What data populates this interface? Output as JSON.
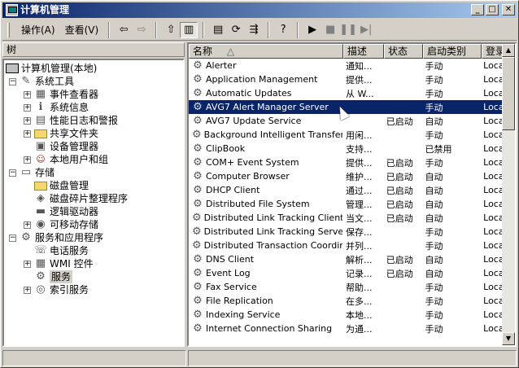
{
  "window": {
    "title": "计算机管理"
  },
  "menu": {
    "action": "操作(A)",
    "view": "查看(V)"
  },
  "toolbar": {
    "back": "⇦",
    "forward": "⇨",
    "up": "⇧",
    "show_tree": "▥",
    "properties": "▤",
    "refresh": "⟳",
    "export": "⇶",
    "help": "?",
    "play": "▶",
    "stop": "■",
    "pause": "❚❚",
    "restart": "▶|"
  },
  "left": {
    "header": "树",
    "tree": [
      {
        "label": "计算机管理(本地)",
        "indent": 0,
        "expander": "",
        "icon": "pc-icon",
        "glyph": ""
      },
      {
        "label": "系统工具",
        "indent": 1,
        "expander": "−",
        "icon": "tools-icon",
        "glyph": "✎"
      },
      {
        "label": "事件查看器",
        "indent": 2,
        "expander": "+",
        "icon": "event-viewer-icon",
        "glyph": "▦"
      },
      {
        "label": "系统信息",
        "indent": 2,
        "expander": "+",
        "icon": "system-info-icon",
        "glyph": "ℹ"
      },
      {
        "label": "性能日志和警报",
        "indent": 2,
        "expander": "+",
        "icon": "perf-log-icon",
        "glyph": "▤"
      },
      {
        "label": "共享文件夹",
        "indent": 2,
        "expander": "+",
        "icon": "shared-folder-icon",
        "glyph": ""
      },
      {
        "label": "设备管理器",
        "indent": 2,
        "expander": "",
        "icon": "device-manager-icon",
        "glyph": "▣"
      },
      {
        "label": "本地用户和组",
        "indent": 2,
        "expander": "+",
        "icon": "users-icon",
        "glyph": "☺"
      },
      {
        "label": "存储",
        "indent": 1,
        "expander": "−",
        "icon": "storage-icon",
        "glyph": "▭"
      },
      {
        "label": "磁盘管理",
        "indent": 2,
        "expander": "",
        "icon": "disk-mgmt-icon",
        "glyph": ""
      },
      {
        "label": "磁盘碎片整理程序",
        "indent": 2,
        "expander": "",
        "icon": "defrag-icon",
        "glyph": "◈"
      },
      {
        "label": "逻辑驱动器",
        "indent": 2,
        "expander": "",
        "icon": "logical-drive-icon",
        "glyph": "▬"
      },
      {
        "label": "可移动存储",
        "indent": 2,
        "expander": "+",
        "icon": "removable-storage-icon",
        "glyph": "◉"
      },
      {
        "label": "服务和应用程序",
        "indent": 1,
        "expander": "−",
        "icon": "services-apps-icon",
        "glyph": "⚙"
      },
      {
        "label": "电话服务",
        "indent": 2,
        "expander": "",
        "icon": "telephony-icon",
        "glyph": "☏"
      },
      {
        "label": "WMI 控件",
        "indent": 2,
        "expander": "+",
        "icon": "wmi-icon",
        "glyph": "▦"
      },
      {
        "label": "服务",
        "indent": 2,
        "expander": "",
        "icon": "services-icon",
        "glyph": "⚙"
      },
      {
        "label": "索引服务",
        "indent": 2,
        "expander": "+",
        "icon": "index-icon",
        "glyph": "◎"
      }
    ]
  },
  "right": {
    "columns": [
      "名称",
      "描述",
      "状态",
      "启动类别",
      "登录"
    ],
    "sort_indicator": "△",
    "rows": [
      {
        "name": "Alerter",
        "desc": "通知...",
        "status": "",
        "start": "手动",
        "logon": "Loca"
      },
      {
        "name": "Application Management",
        "desc": "提供...",
        "status": "",
        "start": "手动",
        "logon": "Loca"
      },
      {
        "name": "Automatic Updates",
        "desc": "从 W...",
        "status": "",
        "start": "手动",
        "logon": "Loca"
      },
      {
        "name": "AVG7 Alert Manager Server",
        "desc": "",
        "status": "",
        "start": "手动",
        "logon": "Loca"
      },
      {
        "name": "AVG7 Update Service",
        "desc": "",
        "status": "已启动",
        "start": "自动",
        "logon": "Loca"
      },
      {
        "name": "Background Intelligent Transfer ...",
        "desc": "用闲...",
        "status": "",
        "start": "手动",
        "logon": "Loca"
      },
      {
        "name": "ClipBook",
        "desc": "支持...",
        "status": "",
        "start": "已禁用",
        "logon": "Loca"
      },
      {
        "name": "COM+ Event System",
        "desc": "提供...",
        "status": "已启动",
        "start": "手动",
        "logon": "Loca"
      },
      {
        "name": "Computer Browser",
        "desc": "维护...",
        "status": "已启动",
        "start": "自动",
        "logon": "Loca"
      },
      {
        "name": "DHCP Client",
        "desc": "通过...",
        "status": "已启动",
        "start": "自动",
        "logon": "Loca"
      },
      {
        "name": "Distributed File System",
        "desc": "管理...",
        "status": "已启动",
        "start": "自动",
        "logon": "Loca"
      },
      {
        "name": "Distributed Link Tracking Client",
        "desc": "当文...",
        "status": "已启动",
        "start": "自动",
        "logon": "Loca"
      },
      {
        "name": "Distributed Link Tracking Server",
        "desc": "保存...",
        "status": "",
        "start": "手动",
        "logon": "Loca"
      },
      {
        "name": "Distributed Transaction Coordin...",
        "desc": "并列...",
        "status": "",
        "start": "手动",
        "logon": "Loca"
      },
      {
        "name": "DNS Client",
        "desc": "解析...",
        "status": "已启动",
        "start": "自动",
        "logon": "Loca"
      },
      {
        "name": "Event Log",
        "desc": "记录...",
        "status": "已启动",
        "start": "自动",
        "logon": "Loca"
      },
      {
        "name": "Fax Service",
        "desc": "帮助...",
        "status": "",
        "start": "手动",
        "logon": "Loca"
      },
      {
        "name": "File Replication",
        "desc": "在多...",
        "status": "",
        "start": "手动",
        "logon": "Loca"
      },
      {
        "name": "Indexing Service",
        "desc": "本地...",
        "status": "",
        "start": "手动",
        "logon": "Loca"
      },
      {
        "name": "Internet Connection Sharing",
        "desc": "为通...",
        "status": "",
        "start": "手动",
        "logon": "Loca"
      }
    ],
    "selected_index": 3
  }
}
